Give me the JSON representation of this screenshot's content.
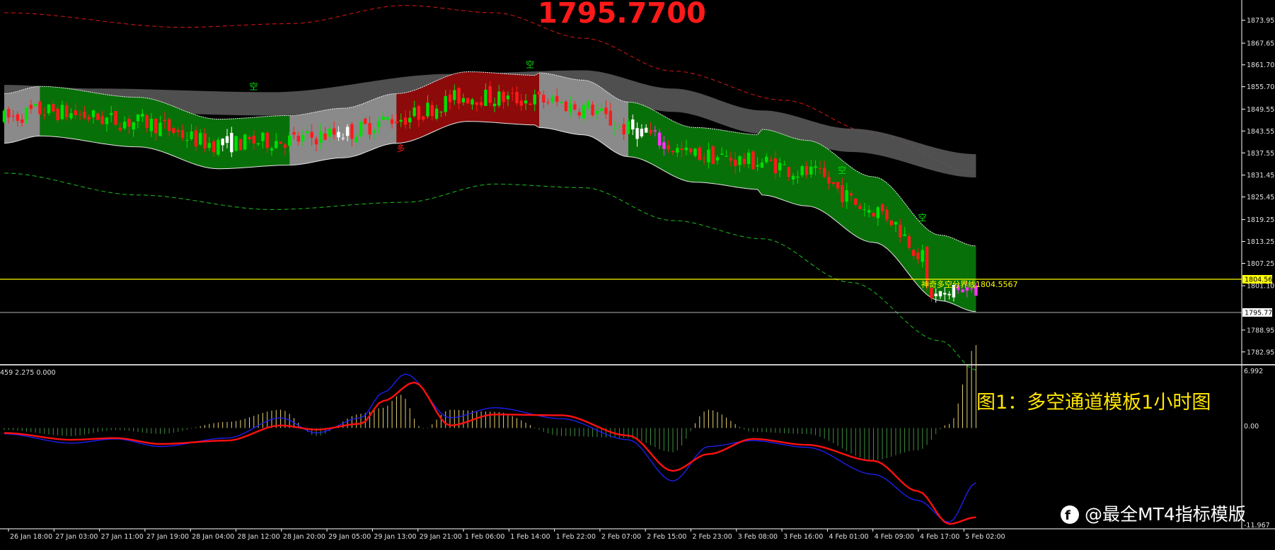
{
  "chart_data": [
    {
      "type": "candlestick",
      "panel": "price",
      "big_price_label": "1795.7700",
      "current_price": 1795.77,
      "current_price_tag": "1795.77",
      "level_line": {
        "value": 1804.56,
        "tag": "1804.56",
        "label": "神奇多空分界线1804.5567"
      },
      "y_ticks": [
        "1873.95",
        "1867.65",
        "1861.70",
        "1855.70",
        "1849.55",
        "1843.55",
        "1837.55",
        "1831.45",
        "1825.45",
        "1819.25",
        "1813.25",
        "1807.25",
        "1801.10",
        "1788.95",
        "1782.95"
      ],
      "ylim": [
        1780,
        1876
      ],
      "signal_labels": [
        "多",
        "空",
        "空",
        "空",
        "空"
      ],
      "channel_segments": [
        {
          "from": 0,
          "to": 8,
          "state": "gray"
        },
        {
          "from": 8,
          "to": 64,
          "state": "green"
        },
        {
          "from": 64,
          "to": 88,
          "state": "gray"
        },
        {
          "from": 88,
          "to": 120,
          "state": "red"
        },
        {
          "from": 120,
          "to": 140,
          "state": "gray"
        },
        {
          "from": 140,
          "to": 218,
          "state": "green"
        }
      ]
    },
    {
      "type": "macd",
      "panel": "oscillator",
      "header": "459 2.275 0.000",
      "y_ticks": [
        "6.992",
        "0.00",
        "-11.967"
      ],
      "ylim": [
        -11.967,
        6.992
      ]
    }
  ],
  "x_ticks": [
    "26 Jan 18:00",
    "27 Jan 03:00",
    "27 Jan 11:00",
    "27 Jan 19:00",
    "28 Jan 04:00",
    "28 Jan 12:00",
    "28 Jan 20:00",
    "29 Jan 05:00",
    "29 Jan 13:00",
    "29 Jan 21:00",
    "1 Feb 06:00",
    "1 Feb 14:00",
    "1 Feb 22:00",
    "2 Feb 07:00",
    "2 Feb 15:00",
    "2 Feb 23:00",
    "3 Feb 08:00",
    "3 Feb 16:00",
    "4 Feb 01:00",
    "4 Feb 09:00",
    "4 Feb 17:00",
    "5 Feb 02:00"
  ],
  "caption": "图1：多空通道模板1小时图",
  "watermark": "@最全MT4指标模版",
  "colors": {
    "background": "#000000",
    "bull": "#00e000",
    "bear": "#ff1a1a",
    "channel_green": "#087008",
    "channel_gray": "#8a8a8a",
    "channel_red": "#8c0a0a",
    "level": "#ffff00",
    "big_price": "#ff1a1a",
    "caption": "#ffe600"
  }
}
